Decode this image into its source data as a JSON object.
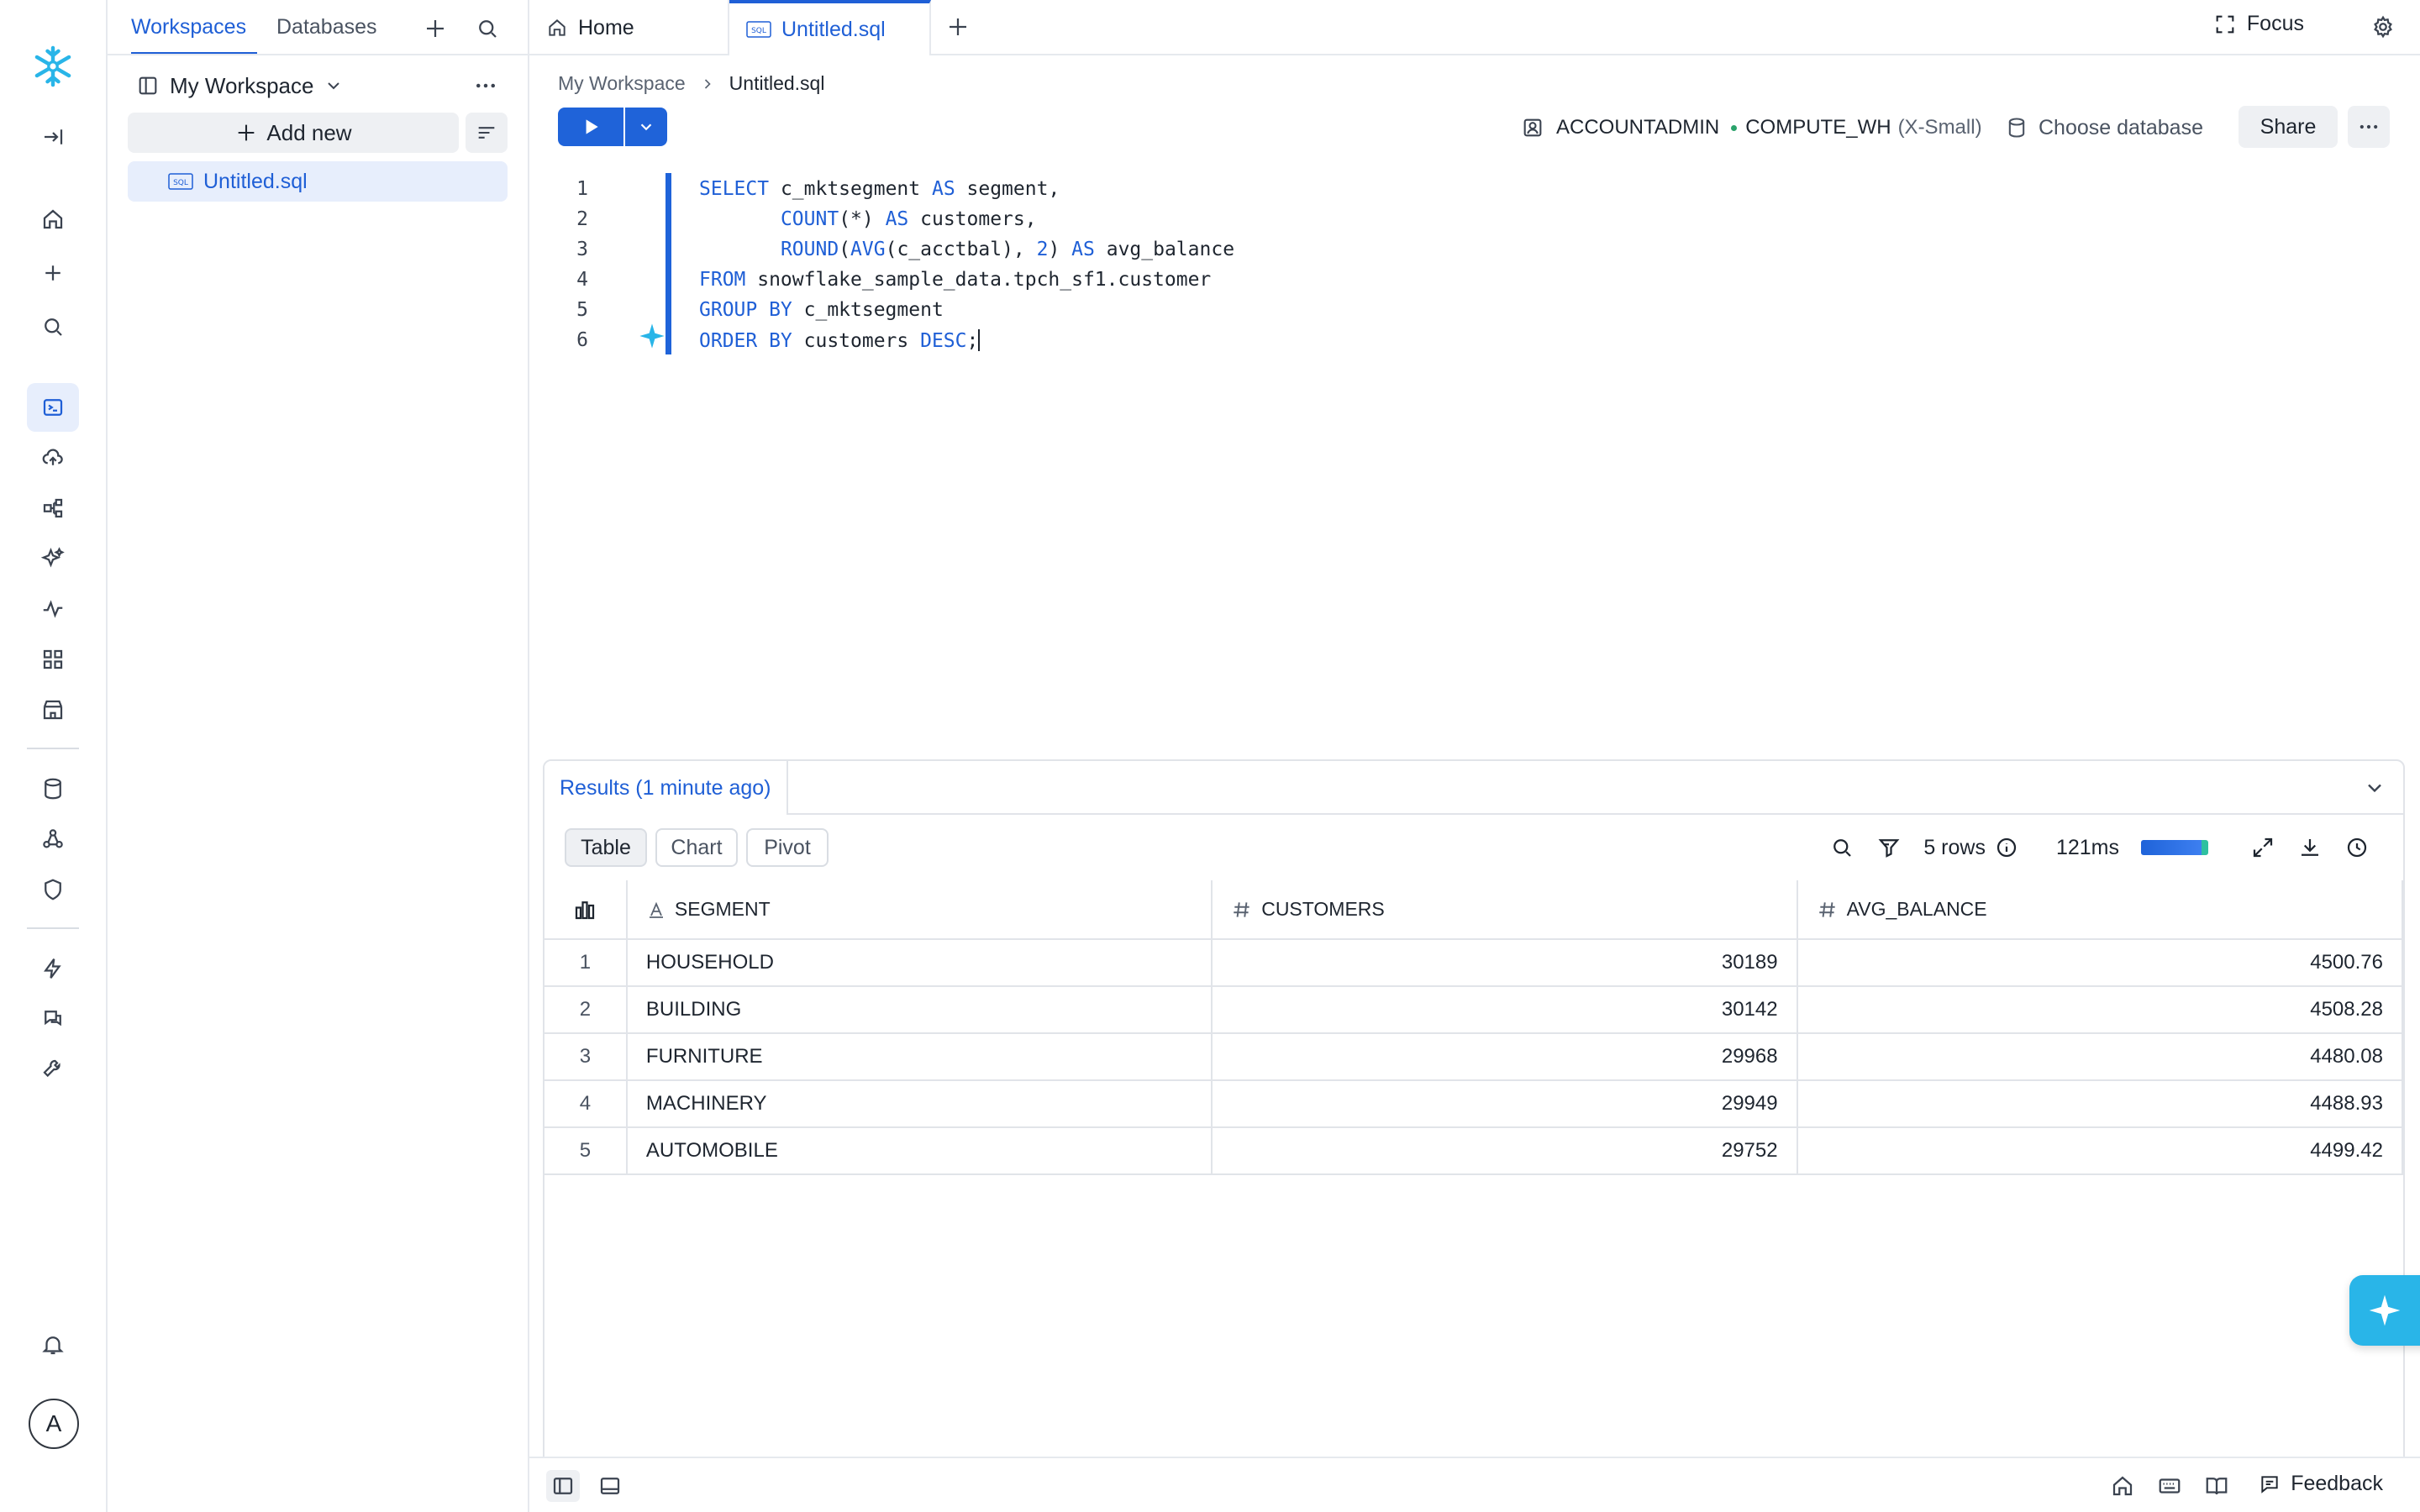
{
  "rail": {
    "items": [
      "home",
      "create",
      "search",
      "projects",
      "data-load",
      "monitoring-graph",
      "ai-ml",
      "activity",
      "apps",
      "marketplace",
      "database",
      "governance",
      "security",
      "performance",
      "support",
      "admin"
    ],
    "avatar_initial": "A"
  },
  "workspace_panel": {
    "tabs": [
      "Workspaces",
      "Databases"
    ],
    "workspace_name": "My Workspace",
    "add_new_label": "Add new",
    "files": [
      "Untitled.sql"
    ]
  },
  "tabbar": {
    "tabs": [
      {
        "label": "Home",
        "active": false
      },
      {
        "label": "Untitled.sql",
        "active": true
      }
    ],
    "focus_label": "Focus"
  },
  "breadcrumb": {
    "parent": "My Workspace",
    "current": "Untitled.sql"
  },
  "toolbar": {
    "role": "ACCOUNTADMIN",
    "warehouse": "COMPUTE_WH",
    "warehouse_size": "(X-Small)",
    "choose_database": "Choose database",
    "share_label": "Share"
  },
  "editor": {
    "line_numbers": [
      "1",
      "2",
      "3",
      "4",
      "5",
      "6"
    ]
  },
  "results": {
    "tab_label": "Results (1 minute ago)",
    "views": [
      "Table",
      "Chart",
      "Pivot"
    ],
    "rows_label": "5 rows",
    "duration": "121ms",
    "columns": [
      "SEGMENT",
      "CUSTOMERS",
      "AVG_BALANCE"
    ],
    "rows": [
      {
        "idx": "1",
        "segment": "HOUSEHOLD",
        "customers": "30189",
        "avg_balance": "4500.76"
      },
      {
        "idx": "2",
        "segment": "BUILDING",
        "customers": "30142",
        "avg_balance": "4508.28"
      },
      {
        "idx": "3",
        "segment": "FURNITURE",
        "customers": "29968",
        "avg_balance": "4480.08"
      },
      {
        "idx": "4",
        "segment": "MACHINERY",
        "customers": "29949",
        "avg_balance": "4488.93"
      },
      {
        "idx": "5",
        "segment": "AUTOMOBILE",
        "customers": "29752",
        "avg_balance": "4499.42"
      }
    ]
  },
  "statusbar": {
    "feedback_label": "Feedback"
  },
  "colors": {
    "accent": "#1f5fd6",
    "brand": "#29b5e8"
  }
}
